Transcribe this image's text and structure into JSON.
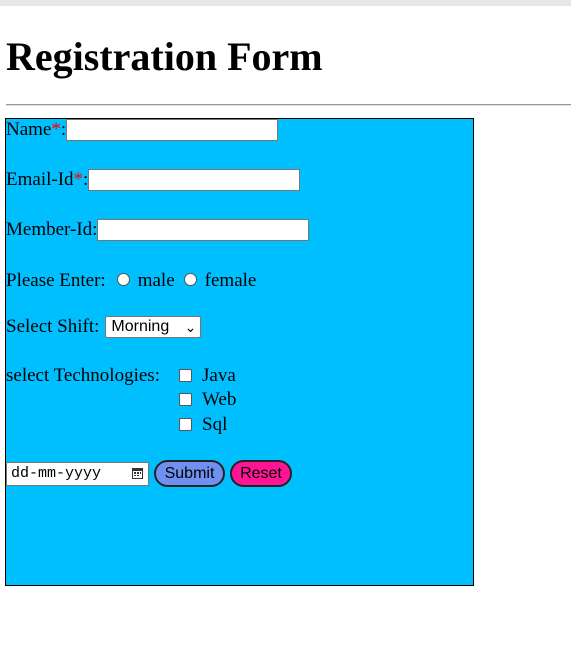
{
  "page": {
    "title": "Registration Form"
  },
  "form": {
    "name_label": "Name",
    "name_required": "*",
    "name_colon": ":",
    "name_value": "",
    "email_label": "Email-Id",
    "email_required": "*",
    "email_colon": ":",
    "email_value": "",
    "member_label": "Member-Id:",
    "member_value": "",
    "gender_label": "Please Enter:",
    "gender_options": [
      "male",
      "female"
    ],
    "shift_label": "Select Shift:",
    "shift_selected": "Morning",
    "tech_label": "select Technologies:",
    "tech_options": [
      "Java",
      "Web",
      "Sql"
    ],
    "date_placeholder": "dd-mm-yyyy",
    "submit_label": "Submit",
    "reset_label": "Reset"
  },
  "colors": {
    "form_background": "#00bfff",
    "required_mark": "#ff0000",
    "submit_button": "#6f90f0",
    "reset_button": "#ff1493"
  },
  "icons": {
    "date_picker": "calendar-icon",
    "shift_dropdown": "chevron-down-icon"
  }
}
